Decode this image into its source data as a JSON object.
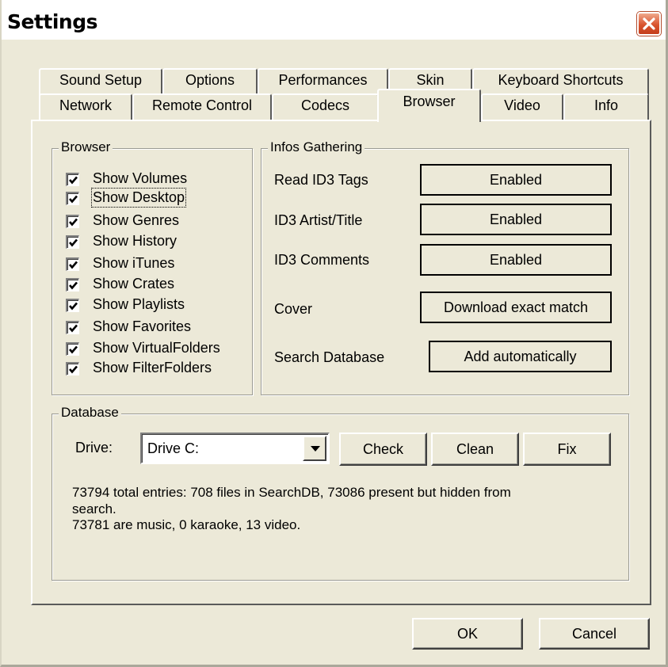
{
  "window": {
    "title": "Settings"
  },
  "tabs_row1": [
    "Sound Setup",
    "Options",
    "Performances",
    "Skin",
    "Keyboard Shortcuts"
  ],
  "tabs_row2": [
    "Network",
    "Remote Control",
    "Codecs",
    "Browser",
    "Video",
    "Info"
  ],
  "active_tab": "Browser",
  "browser_group": {
    "legend": "Browser",
    "items": [
      {
        "label": "Show Volumes",
        "checked": true
      },
      {
        "label": "Show Desktop",
        "checked": true
      },
      {
        "label": "Show Genres",
        "checked": true
      },
      {
        "label": "Show History",
        "checked": true
      },
      {
        "label": "Show iTunes",
        "checked": true
      },
      {
        "label": "Show Crates",
        "checked": true
      },
      {
        "label": "Show Playlists",
        "checked": true
      },
      {
        "label": "Show Favorites",
        "checked": true
      },
      {
        "label": "Show VirtualFolders",
        "checked": true
      },
      {
        "label": "Show FilterFolders",
        "checked": true
      }
    ]
  },
  "infos_group": {
    "legend": "Infos Gathering",
    "rows": [
      {
        "label": "Read ID3 Tags",
        "value": "Enabled"
      },
      {
        "label": "ID3 Artist/Title",
        "value": "Enabled"
      },
      {
        "label": "ID3 Comments",
        "value": "Enabled"
      },
      {
        "label": "Cover",
        "value": "Download exact match"
      },
      {
        "label": "Search Database",
        "value": "Add automatically"
      }
    ]
  },
  "database_group": {
    "legend": "Database",
    "drive_label": "Drive:",
    "drive_value": "Drive C:",
    "check_label": "Check",
    "clean_label": "Clean",
    "fix_label": "Fix",
    "summary_line1": "73794 total entries: 708 files in SearchDB, 73086 present but hidden from",
    "summary_line2": "search.",
    "summary_line3": "73781 are music, 0 karaoke, 13 video."
  },
  "footer": {
    "ok_label": "OK",
    "cancel_label": "Cancel"
  },
  "icons": {
    "close": "close-icon",
    "checkbox_mark": "checkmark-icon",
    "dropdown": "dropdown-arrow-icon"
  },
  "colors": {
    "close_button": "#d9542f",
    "dialog_background": "#ece9d8"
  }
}
